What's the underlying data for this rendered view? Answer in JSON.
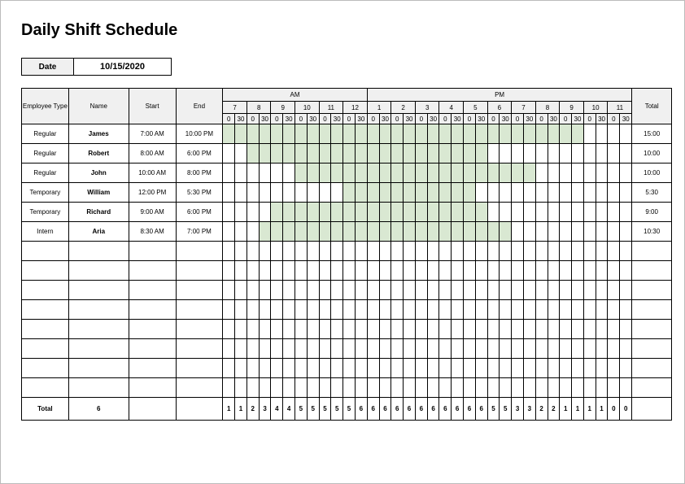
{
  "title": "Daily Shift Schedule",
  "date_label": "Date",
  "date_value": "10/15/2020",
  "headers": {
    "employee_type": "Employee Type",
    "name": "Name",
    "start": "Start",
    "end": "End",
    "am": "AM",
    "pm": "PM",
    "total": "Total"
  },
  "hours_am": [
    "7",
    "8",
    "9",
    "10",
    "11",
    "12"
  ],
  "hours_pm": [
    "1",
    "2",
    "3",
    "4",
    "5",
    "6",
    "7",
    "8",
    "9",
    "10",
    "11"
  ],
  "halves": [
    "0",
    "30"
  ],
  "rows": [
    {
      "type": "Regular",
      "name": "James",
      "start": "7:00 AM",
      "end": "10:00 PM",
      "from": 0,
      "to": 30,
      "total": "15:00"
    },
    {
      "type": "Regular",
      "name": "Robert",
      "start": "8:00 AM",
      "end": "6:00 PM",
      "from": 2,
      "to": 22,
      "total": "10:00"
    },
    {
      "type": "Regular",
      "name": "John",
      "start": "10:00 AM",
      "end": "8:00 PM",
      "from": 6,
      "to": 26,
      "total": "10:00"
    },
    {
      "type": "Temporary",
      "name": "William",
      "start": "12:00 PM",
      "end": "5:30 PM",
      "from": 10,
      "to": 21,
      "total": "5:30"
    },
    {
      "type": "Temporary",
      "name": "Richard",
      "start": "9:00 AM",
      "end": "6:00 PM",
      "from": 4,
      "to": 22,
      "total": "9:00"
    },
    {
      "type": "Intern",
      "name": "Aria",
      "start": "8:30 AM",
      "end": "7:00 PM",
      "from": 3,
      "to": 24,
      "total": "10:30"
    }
  ],
  "empty_rows": 8,
  "totals": {
    "label": "Total",
    "count": "6",
    "slots": [
      "1",
      "1",
      "2",
      "3",
      "4",
      "4",
      "5",
      "5",
      "5",
      "5",
      "5",
      "6",
      "6",
      "6",
      "6",
      "6",
      "6",
      "6",
      "6",
      "6",
      "6",
      "6",
      "5",
      "5",
      "3",
      "3",
      "2",
      "2",
      "1",
      "1",
      "1",
      "1",
      "0",
      "0"
    ]
  },
  "chart_data": {
    "type": "table",
    "title": "Daily Shift Schedule",
    "date": "10/15/2020",
    "employees": [
      {
        "type": "Regular",
        "name": "James",
        "start": "7:00 AM",
        "end": "10:00 PM",
        "total_hours": 15.0
      },
      {
        "type": "Regular",
        "name": "Robert",
        "start": "8:00 AM",
        "end": "6:00 PM",
        "total_hours": 10.0
      },
      {
        "type": "Regular",
        "name": "John",
        "start": "10:00 AM",
        "end": "8:00 PM",
        "total_hours": 10.0
      },
      {
        "type": "Temporary",
        "name": "William",
        "start": "12:00 PM",
        "end": "5:30 PM",
        "total_hours": 5.5
      },
      {
        "type": "Temporary",
        "name": "Richard",
        "start": "9:00 AM",
        "end": "6:00 PM",
        "total_hours": 9.0
      },
      {
        "type": "Intern",
        "name": "Aria",
        "start": "8:30 AM",
        "end": "7:00 PM",
        "total_hours": 10.5
      }
    ],
    "total_employees": 6,
    "half_hour_coverage": {
      "start": "7:00 AM",
      "interval_minutes": 30,
      "counts": [
        1,
        1,
        2,
        3,
        4,
        4,
        5,
        5,
        5,
        5,
        5,
        6,
        6,
        6,
        6,
        6,
        6,
        6,
        6,
        6,
        6,
        6,
        5,
        5,
        3,
        3,
        2,
        2,
        1,
        1,
        1,
        1,
        0,
        0
      ]
    }
  }
}
